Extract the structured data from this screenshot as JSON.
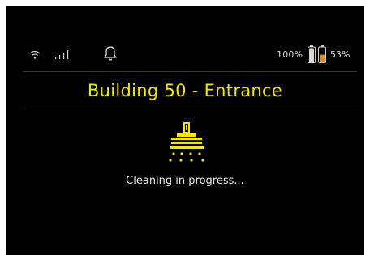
{
  "status_bar": {
    "battery_left_label": "100%",
    "battery_right_label": "53%",
    "battery_left_level": 1.0,
    "battery_right_level": 0.53,
    "icons": [
      "wifi-icon",
      "signal-bars-icon",
      "bell-icon",
      "battery-icon",
      "battery-icon"
    ]
  },
  "main": {
    "location_title": "Building 50 - Entrance",
    "status_message": "Cleaning in progress...",
    "status_icon": "floor-scrubber-icon"
  },
  "colors": {
    "background": "#000000",
    "accent": "#f2e600",
    "battery_low": "#e08a1e",
    "text": "#e8e8e8"
  }
}
